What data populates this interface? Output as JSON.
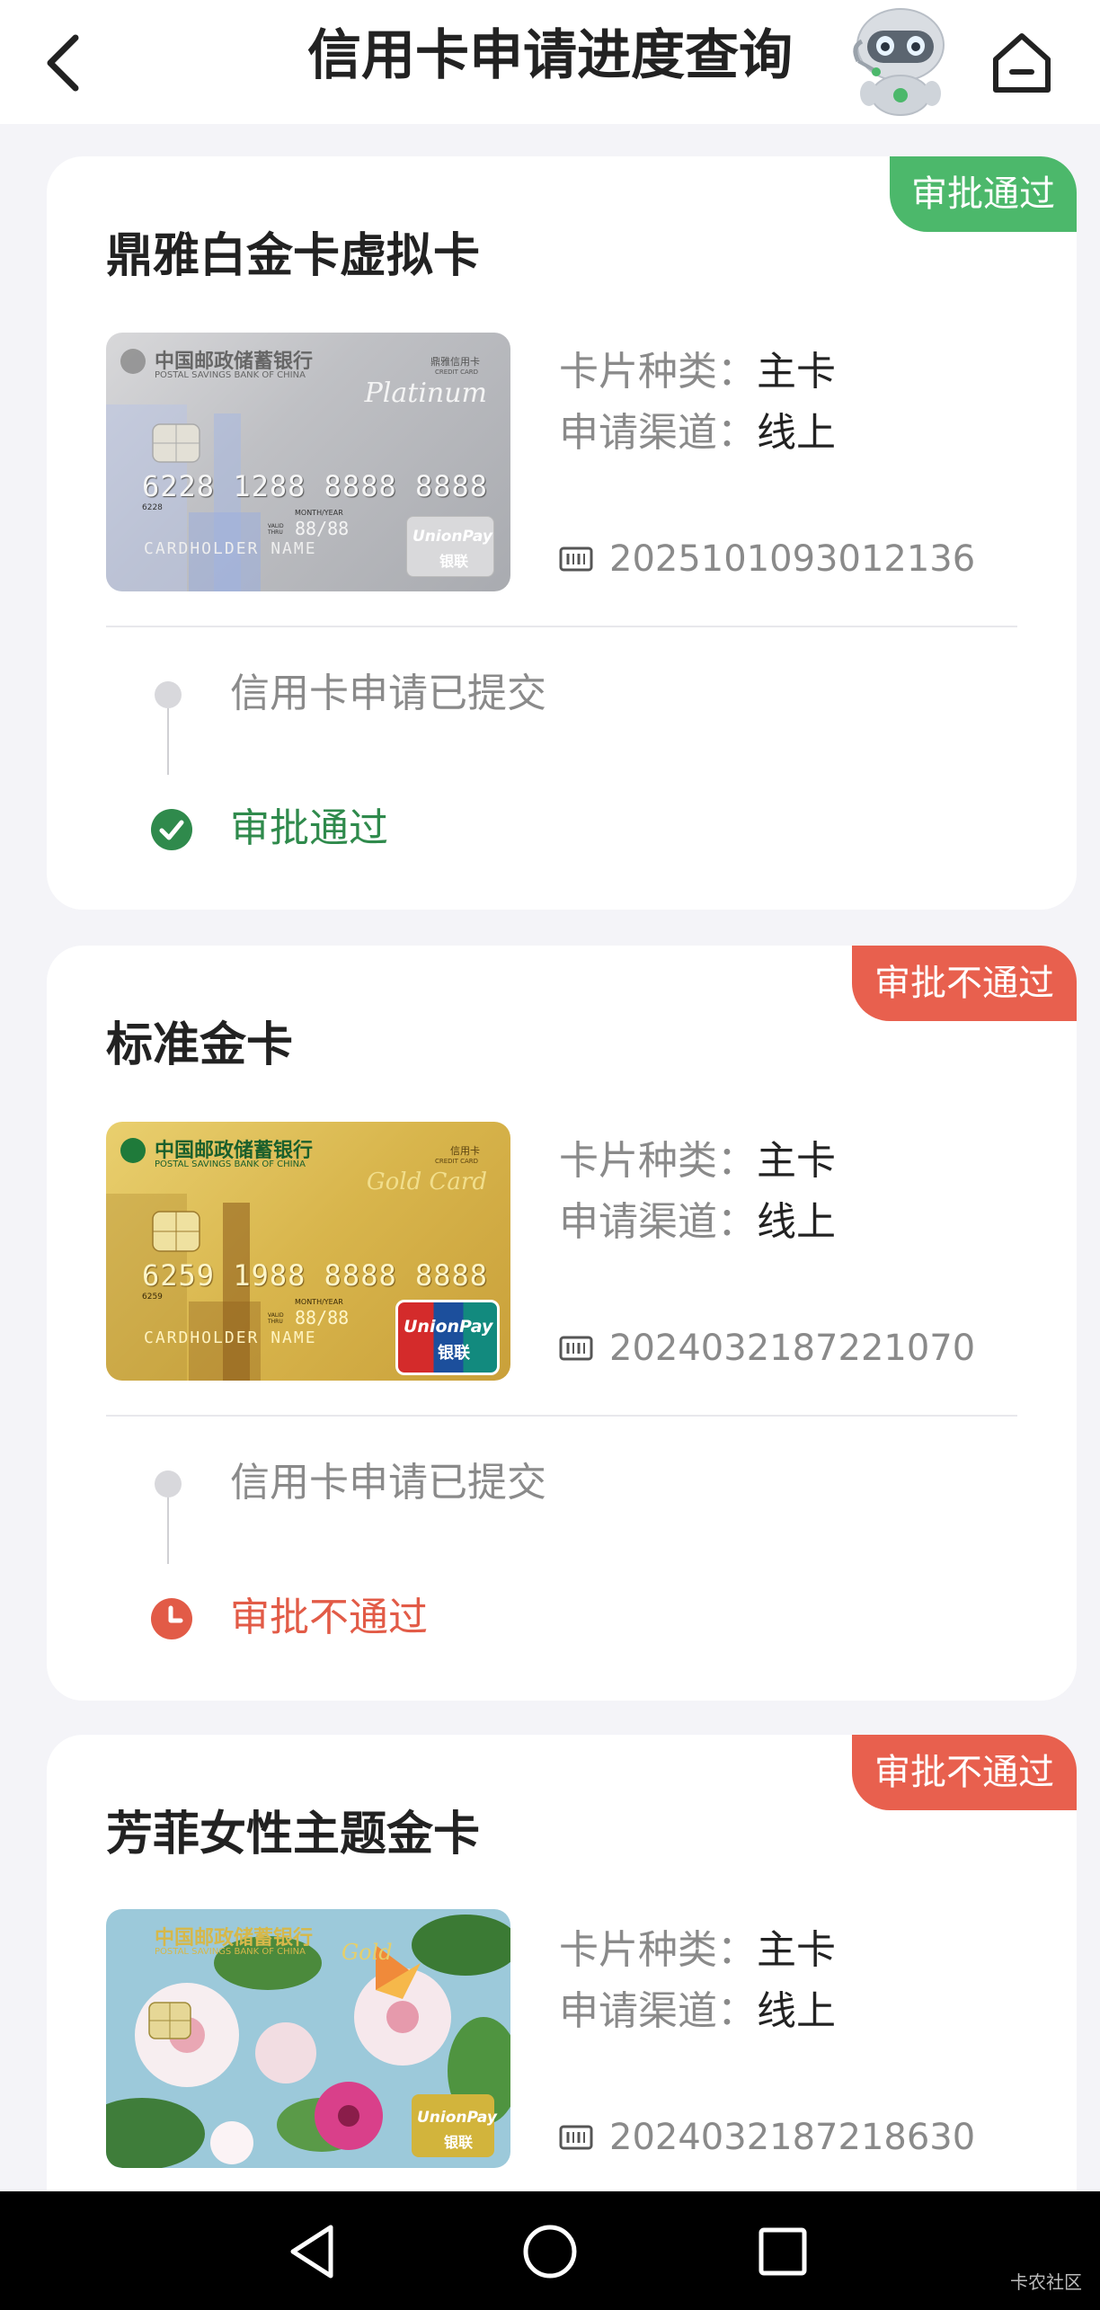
{
  "header": {
    "title": "信用卡申请进度查询",
    "back_icon": "chevron-left-icon",
    "home_icon": "home-icon",
    "assistant_icon": "robot-assistant-icon"
  },
  "applications": [
    {
      "status_badge": "审批通过",
      "card_name": "鼎雅白金卡虚拟卡",
      "type_label": "卡片种类：",
      "type_value": "主卡",
      "channel_label": "申请渠道：",
      "channel_value": "线上",
      "application_no": "2025101093012136",
      "step1": "信用卡申请已提交",
      "step2": "审批通过",
      "card_face": {
        "bank_cn": "中国邮政储蓄银行",
        "bank_en": "POSTAL SAVINGS BANK OF CHINA",
        "product": "鼎雅信用卡",
        "product_en": "CREDIT CARD",
        "tier": "Platinum",
        "number": "6228 1288 8888 8888",
        "small_num": "6228",
        "validity_label": "MONTH/YEAR",
        "valid_thru": "88/88",
        "valid_label": "VALID THRU",
        "holder": "CARDHOLDER NAME",
        "network_en": "UnionPay",
        "network_cn": "银联"
      }
    },
    {
      "status_badge": "审批不通过",
      "card_name": "标准金卡",
      "type_label": "卡片种类：",
      "type_value": "主卡",
      "channel_label": "申请渠道：",
      "channel_value": "线上",
      "application_no": "2024032187221070",
      "step1": "信用卡申请已提交",
      "step2": "审批不通过",
      "card_face": {
        "bank_cn": "中国邮政储蓄银行",
        "bank_en": "POSTAL SAVINGS BANK OF CHINA",
        "product": "信用卡",
        "product_en": "CREDIT CARD",
        "tier": "Gold Card",
        "number": "6259 1988 8888 8888",
        "small_num": "6259",
        "validity_label": "MONTH/YEAR",
        "valid_thru": "88/88",
        "valid_label": "VALID THRU",
        "holder": "CARDHOLDER NAME",
        "network_en": "UnionPay",
        "network_cn": "银联"
      }
    },
    {
      "status_badge": "审批不通过",
      "card_name": "芳菲女性主题金卡",
      "type_label": "卡片种类：",
      "type_value": "主卡",
      "channel_label": "申请渠道：",
      "channel_value": "线上",
      "application_no": "2024032187218630",
      "card_face": {
        "bank_cn": "中国邮政储蓄银行",
        "bank_en": "POSTAL SAVINGS BANK OF CHINA",
        "tier": "Gold",
        "network_en": "UnionPay",
        "network_cn": "银联"
      }
    }
  ],
  "nav": {
    "back": "nav-back-icon",
    "home": "nav-home-icon",
    "recents": "nav-recents-icon"
  },
  "watermark": "卡农社区",
  "colors": {
    "approved": "#4cb86b",
    "rejected": "#e8604e",
    "approved_text": "#2f8a4c",
    "rejected_text": "#e25b47"
  }
}
